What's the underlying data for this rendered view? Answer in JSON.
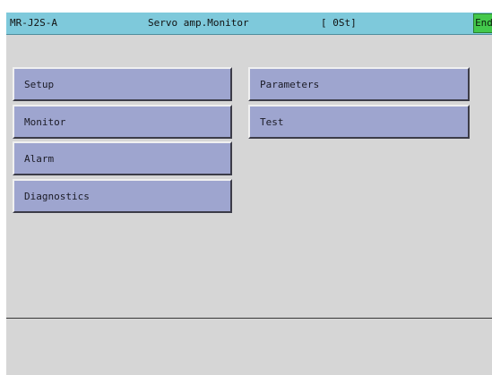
{
  "title_bar": {
    "model": "MR-J2S-A",
    "screen_name": "Servo amp.Monitor",
    "status": "[ 0St]",
    "end_label": "End"
  },
  "menu": {
    "setup": "Setup",
    "monitor": "Monitor",
    "alarm": "Alarm",
    "diagnostics": "Diagnostics",
    "parameters": "Parameters",
    "test": "Test"
  },
  "colors": {
    "title_bar": "#7ec9db",
    "end_button": "#43c84c",
    "menu_button": "#9ea5cf",
    "background": "#d6d6d6"
  }
}
